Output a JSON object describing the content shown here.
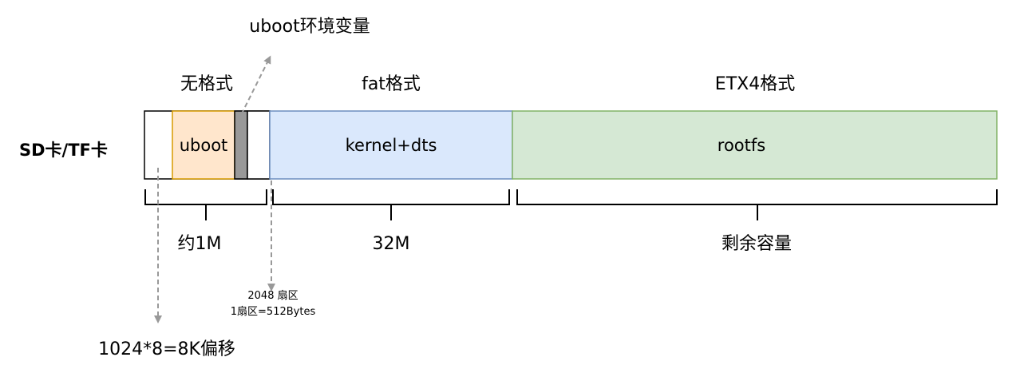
{
  "diagram": {
    "row_label": "SD卡/TF卡",
    "top_labels": {
      "raw": "无格式",
      "fat": "fat格式",
      "ext4": "ETX4格式"
    },
    "blocks": {
      "uboot": "uboot",
      "kernel": "kernel+dts",
      "rootfs": "rootfs"
    },
    "uboot_env_label": "uboot环境变量",
    "size_labels": {
      "raw": "约1M",
      "fat": "32M",
      "ext4": "剩余容量"
    },
    "sector_note": {
      "line1": "2048 扇区",
      "line2": "1扇区=512Bytes"
    },
    "offset_label": "1024*8=8K偏移",
    "colors": {
      "uboot_fill": "#ffe6cc",
      "uboot_stroke": "#d79b00",
      "fat_fill": "#dae8fc",
      "fat_stroke": "#6c8ebf",
      "ext4_fill": "#d5e8d4",
      "ext4_stroke": "#82b366",
      "env_fill": "#999999",
      "arrow": "#999999"
    }
  }
}
